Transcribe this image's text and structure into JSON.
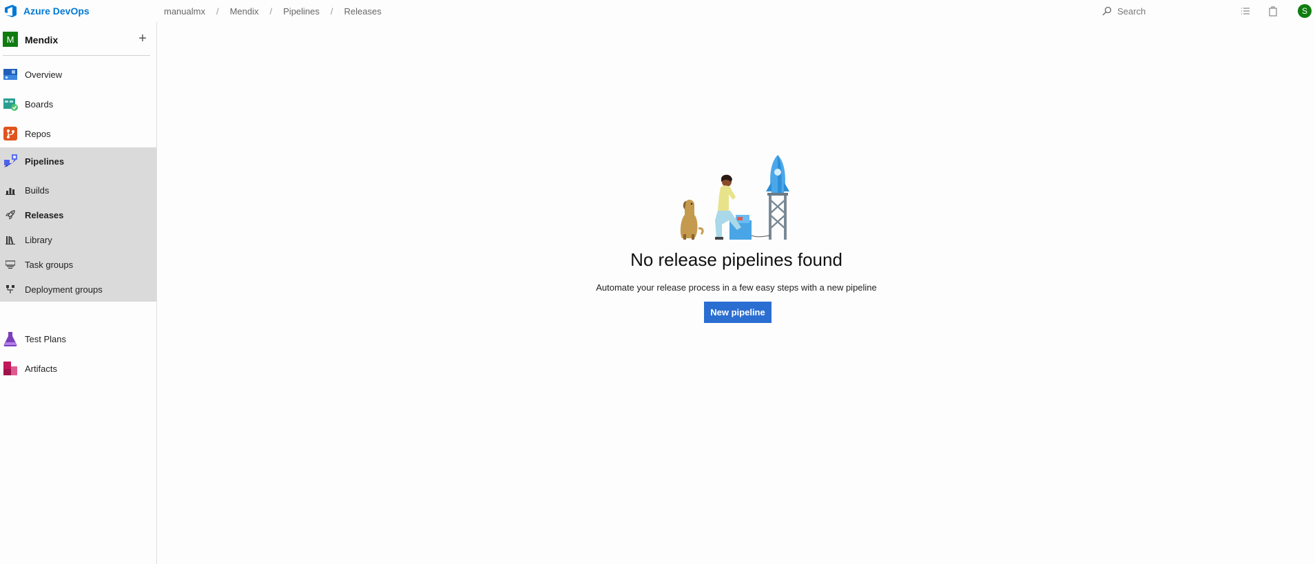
{
  "header": {
    "brand": "Azure DevOps",
    "breadcrumbs": [
      "manualmx",
      "Mendix",
      "Pipelines",
      "Releases"
    ],
    "search_placeholder": "Search",
    "avatar_initial": "S"
  },
  "sidebar": {
    "project": {
      "initial": "M",
      "name": "Mendix",
      "add_label": "+"
    },
    "items": [
      {
        "label": "Overview"
      },
      {
        "label": "Boards"
      },
      {
        "label": "Repos"
      },
      {
        "label": "Pipelines"
      },
      {
        "label": "Test Plans"
      },
      {
        "label": "Artifacts"
      }
    ],
    "pipelines_sub": [
      {
        "label": "Builds"
      },
      {
        "label": "Releases"
      },
      {
        "label": "Library"
      },
      {
        "label": "Task groups"
      },
      {
        "label": "Deployment groups"
      }
    ]
  },
  "main": {
    "title": "No release pipelines found",
    "subtitle": "Automate your release process in a few easy steps with a new pipeline",
    "button": "New pipeline"
  },
  "colors": {
    "brand": "#0078d4",
    "project_badge": "#107c10",
    "primary_button": "#2b6ed1",
    "selected_group_bg": "#dadada"
  }
}
